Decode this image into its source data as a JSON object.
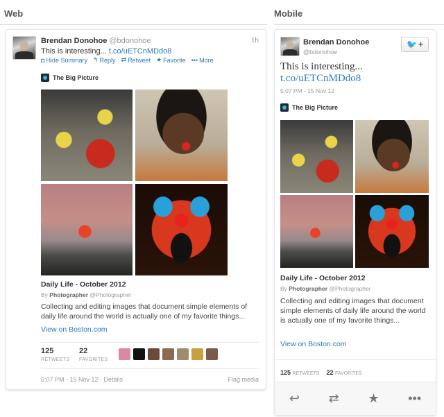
{
  "sections": {
    "web": "Web",
    "mobile": "Mobile"
  },
  "tweet": {
    "name": "Brendan Donohoe",
    "handle": "@bdonohoe",
    "time": "1h",
    "text": "This is interesting...",
    "link": "t.co/uETCnMDdo8",
    "timestamp_web": "5:07 PM - 15 Nov 12 · Details",
    "timestamp_mobile": "5:07 PM - 15 Nov 12",
    "flag": "Flag media"
  },
  "actions": [
    {
      "icon": "◘",
      "label": "Hide Summary",
      "name": "hide-summary"
    },
    {
      "icon": "↰",
      "label": "Reply",
      "name": "reply"
    },
    {
      "icon": "⇄",
      "label": "Retweet",
      "name": "retweet"
    },
    {
      "icon": "★",
      "label": "Favorite",
      "name": "favorite"
    },
    {
      "icon": "•••",
      "label": "More",
      "name": "more"
    }
  ],
  "card": {
    "source": "The Big Picture",
    "title": "Daily Life - October 2012",
    "by_prefix": "By",
    "author": "Photographer",
    "author_handle": "@Photographer",
    "description": "Collecting and editing images that document simple elements of daily life around the world is actually one of my favorite things...",
    "view_link": "View on Boston.com"
  },
  "stats": {
    "retweets": "125",
    "retweets_label": "RETWEETS",
    "favorites": "22",
    "favorites_label": "FAVORITES"
  },
  "favoriter_colors": [
    "#d88aa0",
    "#111111",
    "#6a4a3a",
    "#8a6a50",
    "#a08a70",
    "#c8a040",
    "#7a5a4a"
  ],
  "mobile_actions": [
    {
      "icon": "↩",
      "name": "reply-icon"
    },
    {
      "icon": "⇄",
      "name": "retweet-icon"
    },
    {
      "icon": "★",
      "name": "favorite-icon"
    },
    {
      "icon": "•••",
      "name": "more-icon"
    }
  ],
  "follow_button": {
    "bird": "🐦",
    "plus": "+"
  }
}
